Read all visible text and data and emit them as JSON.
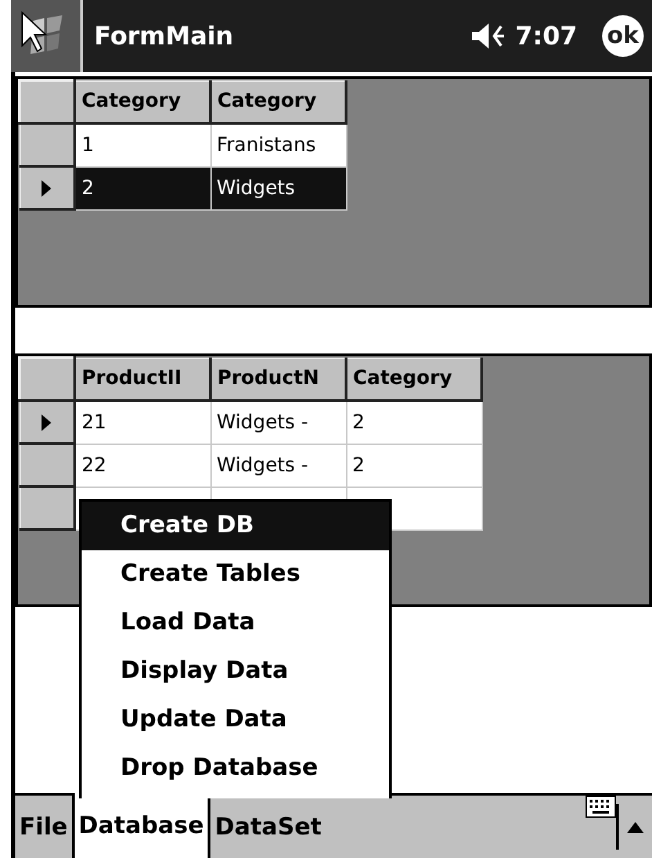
{
  "title_bar": {
    "title": "FormMain",
    "time": "7:07",
    "ok_button": "ok"
  },
  "grids": [
    {
      "columns": [
        "Category",
        "Category"
      ],
      "rows": [
        {
          "cells": [
            "1",
            "Franistans"
          ],
          "current": false,
          "selected": false
        },
        {
          "cells": [
            "2",
            "Widgets"
          ],
          "current": true,
          "selected": true
        }
      ]
    },
    {
      "columns": [
        "ProductII",
        "ProductN",
        "Category"
      ],
      "new_row": true,
      "rows": [
        {
          "cells": [
            "21",
            "Widgets -",
            "2"
          ],
          "current": true,
          "selected": false
        },
        {
          "cells": [
            "22",
            "Widgets -",
            "2"
          ],
          "current": false,
          "selected": false
        }
      ]
    }
  ],
  "menu": {
    "items": [
      {
        "label": "Create DB",
        "selected": true
      },
      {
        "label": "Create Tables",
        "selected": false
      },
      {
        "label": "Load Data",
        "selected": false
      },
      {
        "label": "Display Data",
        "selected": false
      },
      {
        "label": "Update Data",
        "selected": false
      },
      {
        "label": "Drop Database",
        "selected": false
      }
    ]
  },
  "menu_bar": {
    "items": [
      {
        "label": "File",
        "selected": false
      },
      {
        "label": "Database",
        "selected": true
      },
      {
        "label": "DataSet",
        "selected": false
      }
    ]
  }
}
